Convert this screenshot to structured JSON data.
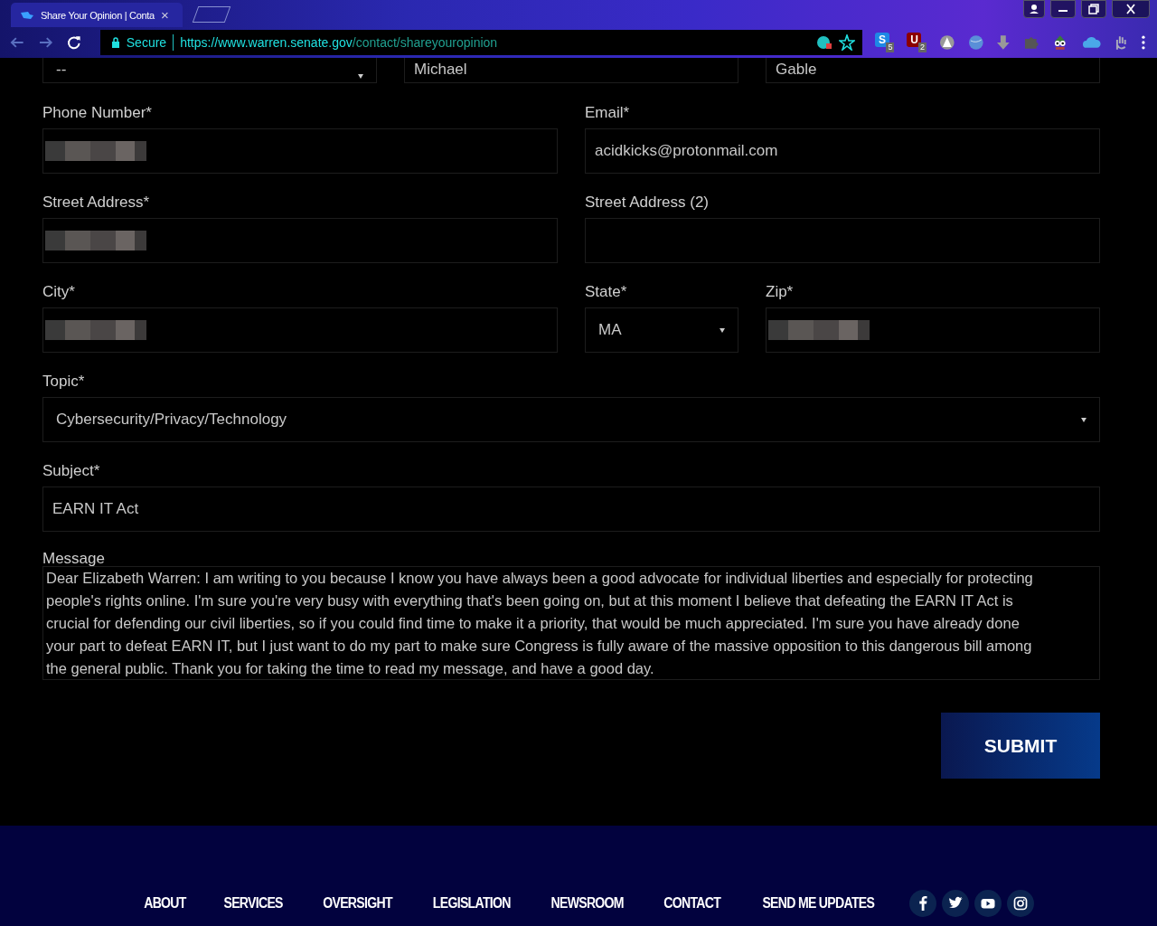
{
  "browser": {
    "tab": {
      "title": "Share Your Opinion | Conta",
      "close": "×"
    },
    "address": {
      "security": "Secure",
      "host": "https://www.warren.senate.gov",
      "path": "/contact/shareyouropinion"
    },
    "extensions": [
      {
        "kind": "letter",
        "letter": "S",
        "badge": "5",
        "color": "#1e88e5"
      },
      {
        "kind": "letter",
        "letter": "U",
        "badge": "2",
        "color": "#8b0000"
      },
      {
        "kind": "triangle"
      },
      {
        "kind": "globe"
      },
      {
        "kind": "download"
      },
      {
        "kind": "puzzle"
      },
      {
        "kind": "owl"
      },
      {
        "kind": "cloud"
      },
      {
        "kind": "hand"
      }
    ]
  },
  "form": {
    "rows": [
      {
        "kind": "thirds",
        "fields": [
          {
            "kind": "select",
            "value": "--"
          },
          {
            "kind": "text",
            "value": "Michael"
          },
          {
            "kind": "text",
            "value": "Gable"
          }
        ]
      },
      {
        "kind": "halves",
        "fields": [
          {
            "kind": "redacted",
            "label": "Phone Number*"
          },
          {
            "kind": "text",
            "label": "Email*",
            "value": "acidkicks@protonmail.com"
          }
        ]
      },
      {
        "kind": "halves",
        "fields": [
          {
            "kind": "redacted",
            "label": "Street Address*"
          },
          {
            "kind": "text",
            "label": "Street Address (2)"
          }
        ]
      },
      {
        "kind": "location",
        "fields": [
          {
            "kind": "redacted",
            "label": "City*"
          },
          {
            "kind": "select",
            "label": "State*",
            "value": "MA"
          },
          {
            "kind": "redacted",
            "label": "Zip*"
          }
        ]
      },
      {
        "kind": "full",
        "fields": [
          {
            "kind": "select",
            "label": "Topic*",
            "value": "Cybersecurity/Privacy/Technology"
          }
        ]
      },
      {
        "kind": "full",
        "fields": [
          {
            "kind": "text",
            "label": "Subject*",
            "value": "EARN IT Act"
          }
        ]
      }
    ],
    "message": {
      "label": "Message",
      "value": "Dear Elizabeth Warren: I am writing to you because I know you have always been a good advocate for individual liberties and especially for protecting people's rights online. I'm sure you're very busy with everything that's been going on, but at this moment I believe that defeating the EARN IT Act is crucial for defending our civil liberties, so if you could find time to make it a priority, that would be much appreciated. I'm sure you have already done your part to defeat EARN IT, but I just want to do my part to make sure Congress is fully aware of the massive opposition to this dangerous bill among the general public. Thank you for taking the time to read my message, and have a good day."
    },
    "submit": "SUBMIT"
  },
  "footer": {
    "links": [
      "ABOUT",
      "SERVICES",
      "OVERSIGHT",
      "LEGISLATION",
      "NEWSROOM",
      "CONTACT",
      "SEND ME UPDATES"
    ],
    "social": [
      {
        "kind": "facebook"
      },
      {
        "kind": "twitter"
      },
      {
        "kind": "youtube"
      },
      {
        "kind": "instagram"
      }
    ]
  }
}
